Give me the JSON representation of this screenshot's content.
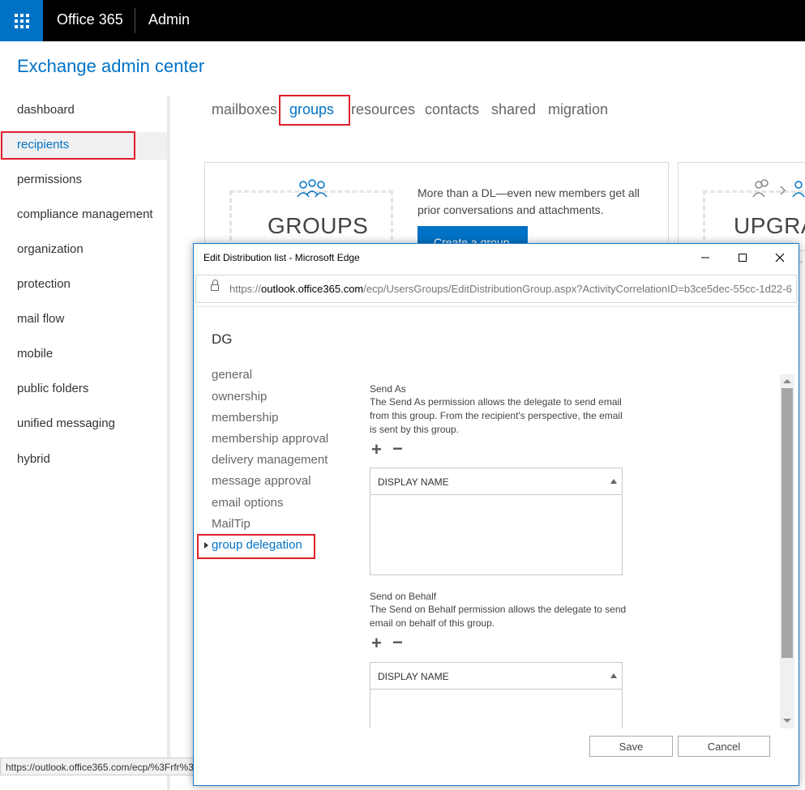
{
  "topbar": {
    "brand": "Office 365",
    "section": "Admin"
  },
  "app_title": "Exchange admin center",
  "leftnav": {
    "items": [
      {
        "label": "dashboard"
      },
      {
        "label": "recipients"
      },
      {
        "label": "permissions"
      },
      {
        "label": "compliance management"
      },
      {
        "label": "organization"
      },
      {
        "label": "protection"
      },
      {
        "label": "mail flow"
      },
      {
        "label": "mobile"
      },
      {
        "label": "public folders"
      },
      {
        "label": "unified messaging"
      },
      {
        "label": "hybrid"
      }
    ],
    "active": "recipients"
  },
  "tabs": [
    {
      "label": "mailboxes"
    },
    {
      "label": "groups"
    },
    {
      "label": "resources"
    },
    {
      "label": "contacts"
    },
    {
      "label": "shared"
    },
    {
      "label": "migration"
    }
  ],
  "cards": {
    "groups": {
      "title": "GROUPS",
      "text": "More than a DL—even new members get all prior conversations and attachments.",
      "button": "Create a group"
    },
    "upgrade": {
      "title": "UPGRA"
    }
  },
  "statusbar": {
    "url": "https://outlook.office365.com/ecp/%3Frfr%3"
  },
  "dialog": {
    "window_title": "Edit Distribution list - Microsoft Edge",
    "url_prefix": "https://",
    "url_domain": "outlook.office365.com",
    "url_path": "/ecp/UsersGroups/EditDistributionGroup.aspx?ActivityCorrelationID=b3ce5dec-55cc-1d22-6",
    "group_name": "DG",
    "nav": [
      {
        "label": "general"
      },
      {
        "label": "ownership"
      },
      {
        "label": "membership"
      },
      {
        "label": "membership approval"
      },
      {
        "label": "delivery management"
      },
      {
        "label": "message approval"
      },
      {
        "label": "email options"
      },
      {
        "label": "MailTip"
      },
      {
        "label": "group delegation"
      }
    ],
    "send_as": {
      "title": "Send As",
      "desc": "The Send As permission allows the delegate to send email from this group. From the recipient's perspective, the email is sent by this group.",
      "column": "DISPLAY NAME"
    },
    "send_on_behalf": {
      "title": "Send on Behalf",
      "desc": "The Send on Behalf permission allows the delegate to send email on behalf of this group.",
      "column": "DISPLAY NAME"
    },
    "save": "Save",
    "cancel": "Cancel"
  },
  "colors": {
    "accent": "#0072c6",
    "highlight": "#e01e2b",
    "topbar": "#000000"
  }
}
